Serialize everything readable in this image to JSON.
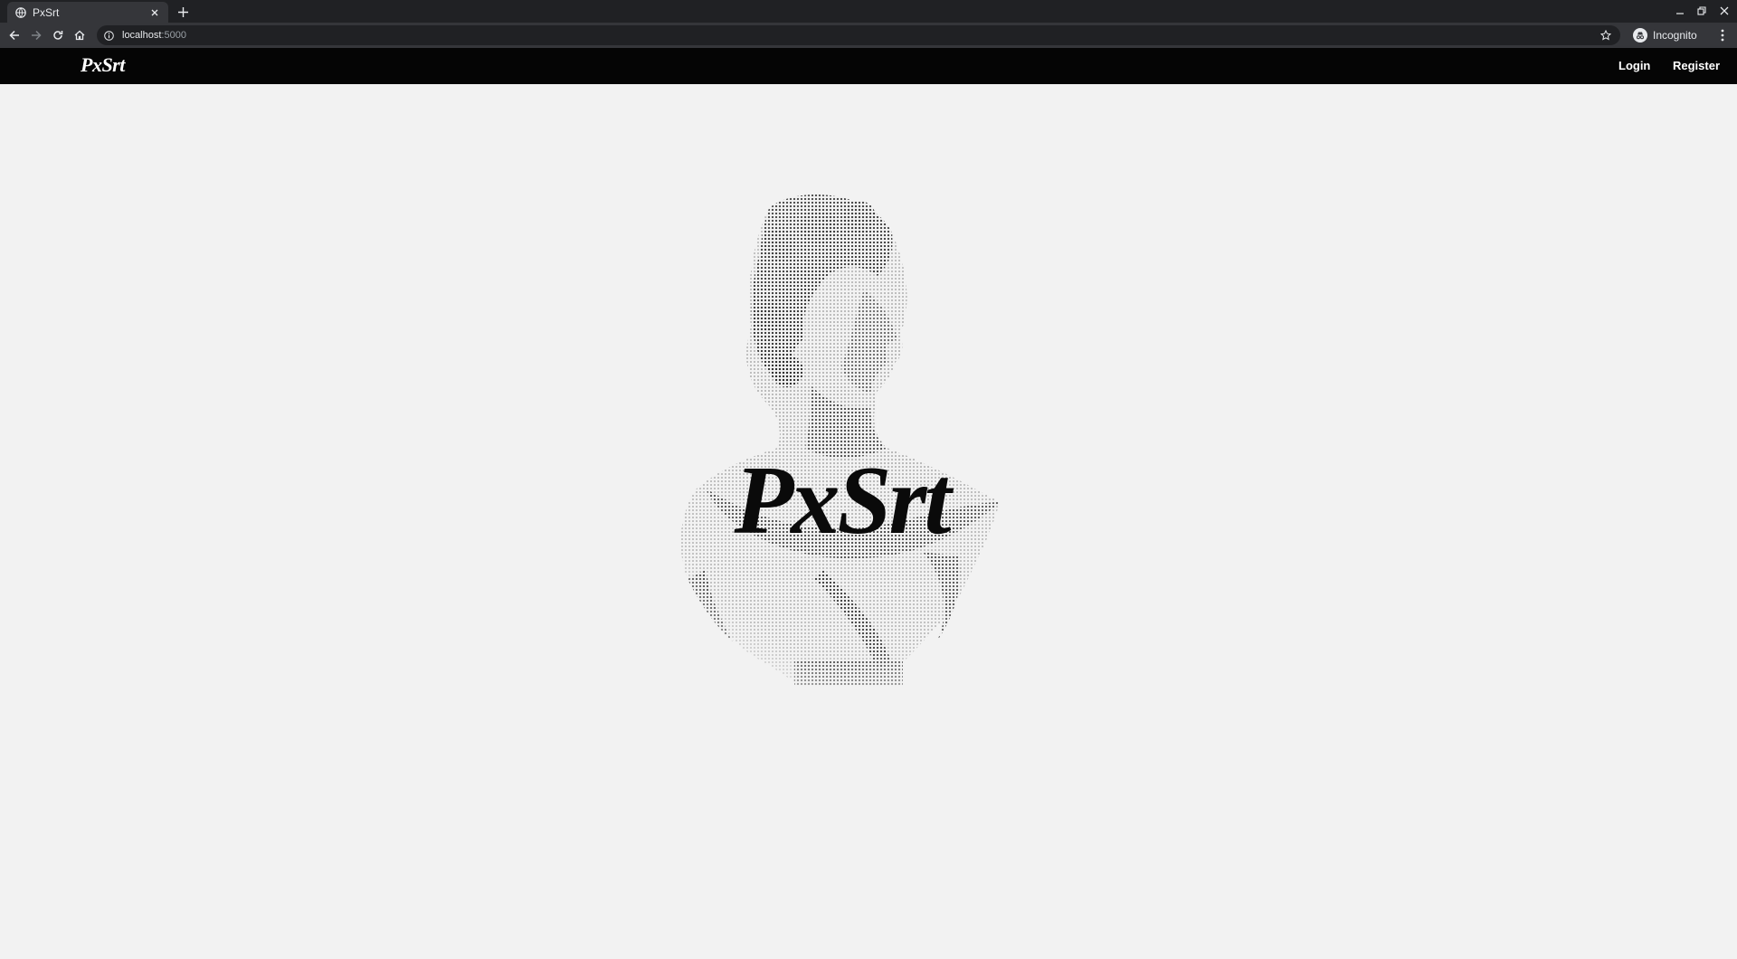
{
  "browser": {
    "tab_title": "PxSrt",
    "url_host": "localhost",
    "url_port": ":5000",
    "profile_label": "Incognito",
    "icons": {
      "favicon": "globe-icon",
      "close": "close-icon",
      "new_tab": "plus-icon",
      "back": "arrow-left-icon",
      "forward": "arrow-right-icon",
      "reload": "reload-icon",
      "home": "home-icon",
      "site_info": "info-icon",
      "bookmark": "star-icon",
      "profile": "incognito-icon",
      "menu": "kebab-menu-icon",
      "minimize": "minimize-icon",
      "restore": "restore-icon",
      "window_close": "window-close-icon"
    },
    "colors": {
      "tabstrip": "#202124",
      "toolbar": "#35363a",
      "text": "#e8eaed"
    }
  },
  "site": {
    "brand": "PxSrt",
    "nav": {
      "login": "Login",
      "register": "Register"
    },
    "hero": {
      "title": "PxSrt",
      "image": "halftone-greek-statue-bust"
    },
    "colors": {
      "navbar": "#050505",
      "background": "#f2f2f2",
      "title": "#0a0a0a"
    }
  }
}
